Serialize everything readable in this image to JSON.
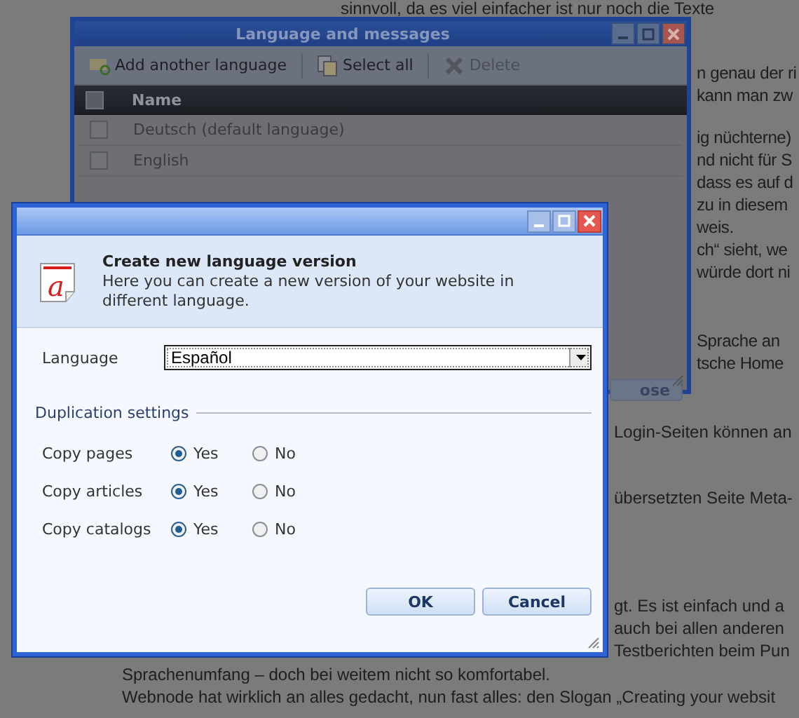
{
  "background_text": [
    {
      "kind": "wide",
      "lines": [
        "sinnvoll, da es viel einfacher ist nur noch die Texte"
      ]
    },
    {
      "kind": "right",
      "lines": [
        "n genau der ri",
        "kann man zw"
      ]
    },
    {
      "kind": "right",
      "lines": [
        "ig nüchterne)",
        "nd nicht für S",
        "dass es auf d",
        "zu in diesem",
        "weis.",
        "ch“ sieht, we",
        "würde dort ni"
      ]
    },
    {
      "kind": "right",
      "lines": [
        "Sprache an",
        "tsche Home"
      ]
    },
    {
      "kind": "middle",
      "lines": [
        "Login-Seiten können an"
      ]
    },
    {
      "kind": "middle",
      "lines": [
        "übersetzten Seite Meta-"
      ]
    },
    {
      "kind": "middle",
      "lines": [
        "gt. Es ist einfach und a",
        "auch bei allen anderen",
        "Testberichten beim Pun"
      ]
    },
    {
      "kind": "left",
      "lines": [
        "Sprachenumfang – doch bei weitem nicht so komfortabel.",
        "Webnode hat wirklich an alles gedacht, nun fast alles: den Slogan „Creating your websit"
      ]
    }
  ],
  "main_window": {
    "title": "Language and messages",
    "toolbar": [
      {
        "kind": "add",
        "label": "Add another language",
        "disabled": false
      },
      {
        "kind": "select",
        "label": "Select all",
        "disabled": false
      },
      {
        "kind": "delete",
        "label": "Delete",
        "disabled": true
      }
    ],
    "table": {
      "all_checked": false,
      "columns": [
        "Name"
      ],
      "rows": [
        {
          "name": "Deutsch (default language)",
          "checked": false
        },
        {
          "name": "English",
          "checked": false
        }
      ]
    },
    "partial_button": "ose"
  },
  "dialog": {
    "icon_letter": "a",
    "heading": "Create new language version",
    "description": "Here you can create a new version of your website in different language.",
    "language": {
      "label": "Language",
      "value": "Español"
    },
    "section": "Duplication settings",
    "options": [
      {
        "label": "Copy pages",
        "choices": [
          {
            "label": "Yes",
            "selected": true
          },
          {
            "label": "No",
            "selected": false
          }
        ]
      },
      {
        "label": "Copy articles",
        "choices": [
          {
            "label": "Yes",
            "selected": true
          },
          {
            "label": "No",
            "selected": false
          }
        ]
      },
      {
        "label": "Copy catalogs",
        "choices": [
          {
            "label": "Yes",
            "selected": true
          },
          {
            "label": "No",
            "selected": false
          }
        ]
      }
    ],
    "buttons": [
      "OK",
      "Cancel"
    ]
  }
}
